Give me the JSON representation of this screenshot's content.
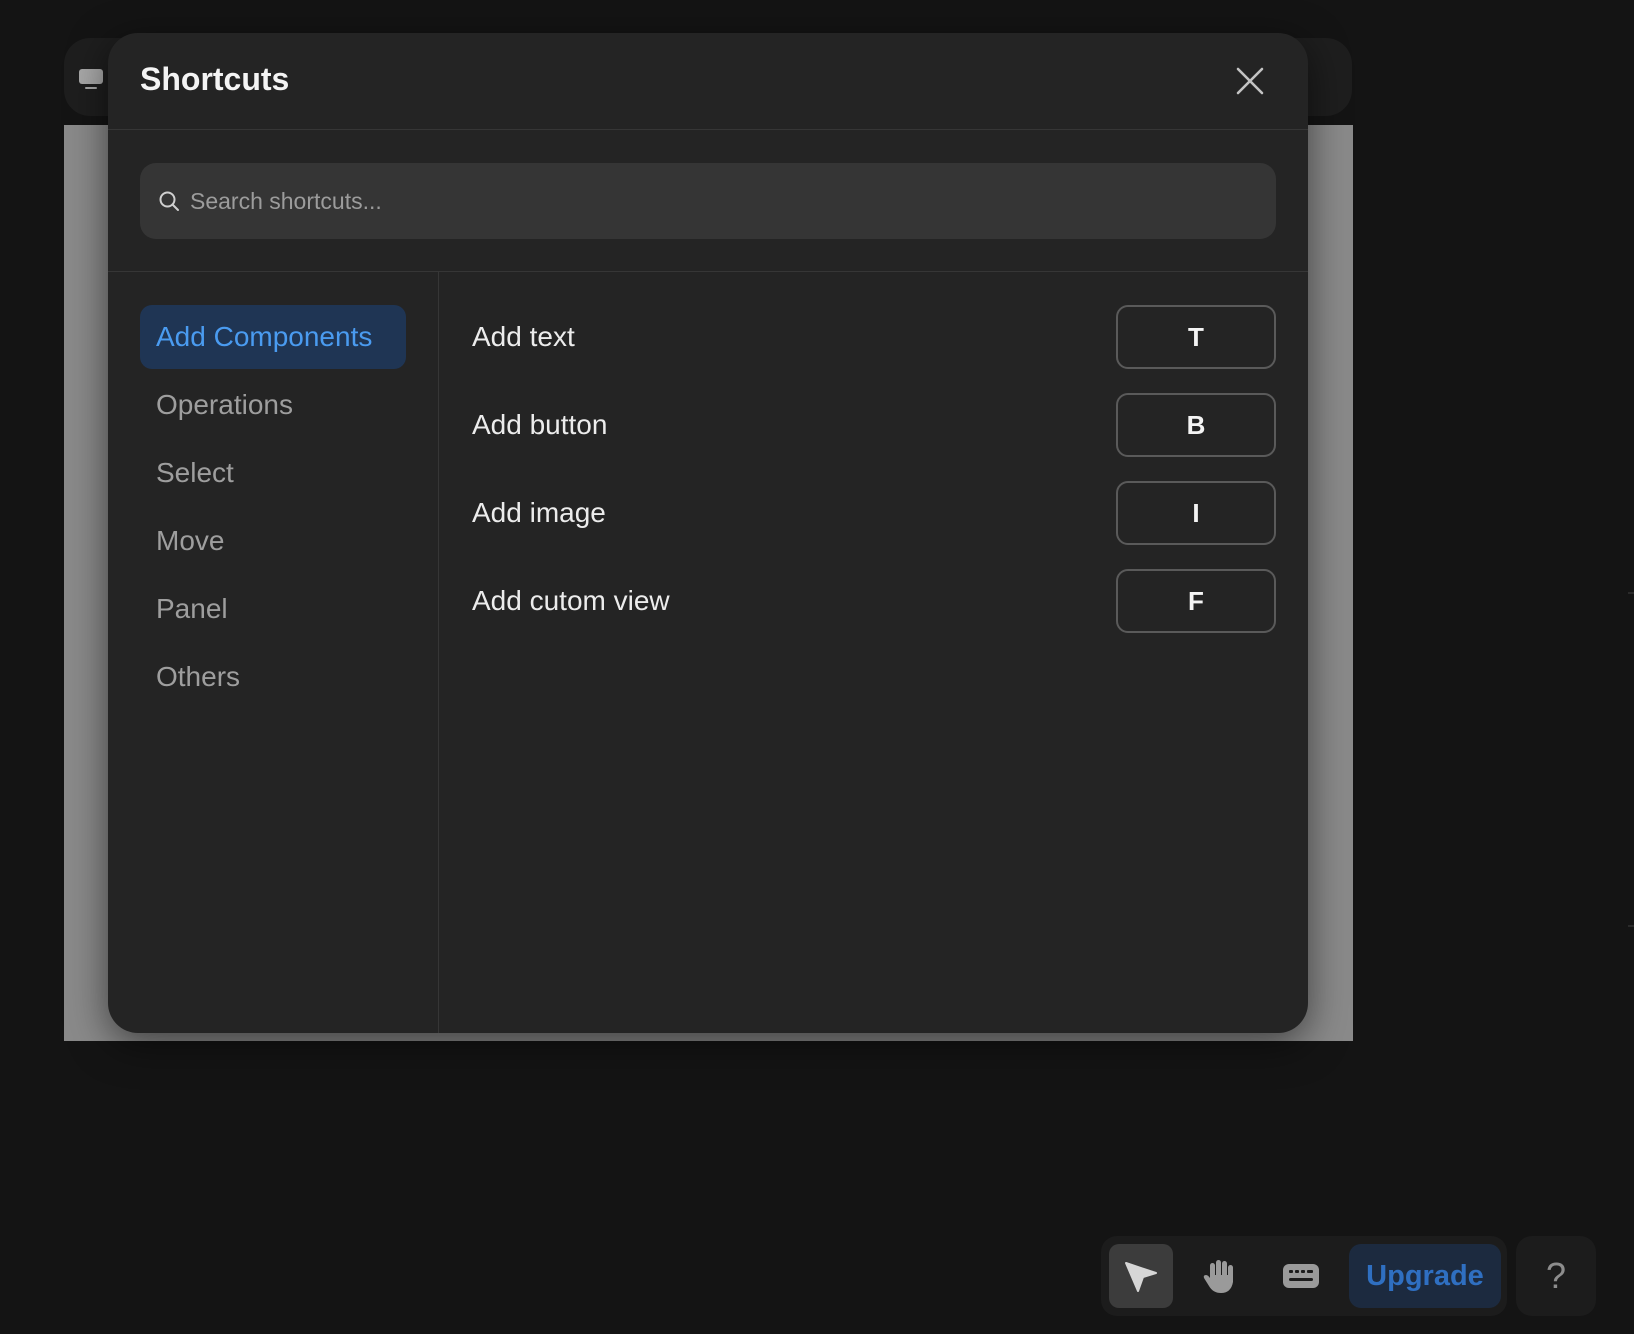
{
  "modal": {
    "title": "Shortcuts",
    "search": {
      "placeholder": "Search shortcuts...",
      "value": ""
    },
    "categories": [
      {
        "label": "Add Components",
        "active": true
      },
      {
        "label": "Operations",
        "active": false
      },
      {
        "label": "Select",
        "active": false
      },
      {
        "label": "Move",
        "active": false
      },
      {
        "label": "Panel",
        "active": false
      },
      {
        "label": "Others",
        "active": false
      }
    ],
    "shortcuts": [
      {
        "label": "Add text",
        "key": "T"
      },
      {
        "label": "Add button",
        "key": "B"
      },
      {
        "label": "Add image",
        "key": "I"
      },
      {
        "label": "Add cutom view",
        "key": "F"
      }
    ]
  },
  "toolbar": {
    "tools": [
      {
        "name": "pointer-icon",
        "active": true
      },
      {
        "name": "hand-icon",
        "active": false
      },
      {
        "name": "keyboard-icon",
        "active": false
      }
    ],
    "upgrade_label": "Upgrade",
    "help_label": "?"
  },
  "colors": {
    "accent": "#4a9bf0",
    "active_category_bg": "#1f3554",
    "upgrade_text": "#2f6fc1",
    "modal_bg": "#242424",
    "page_bg": "#141414"
  }
}
